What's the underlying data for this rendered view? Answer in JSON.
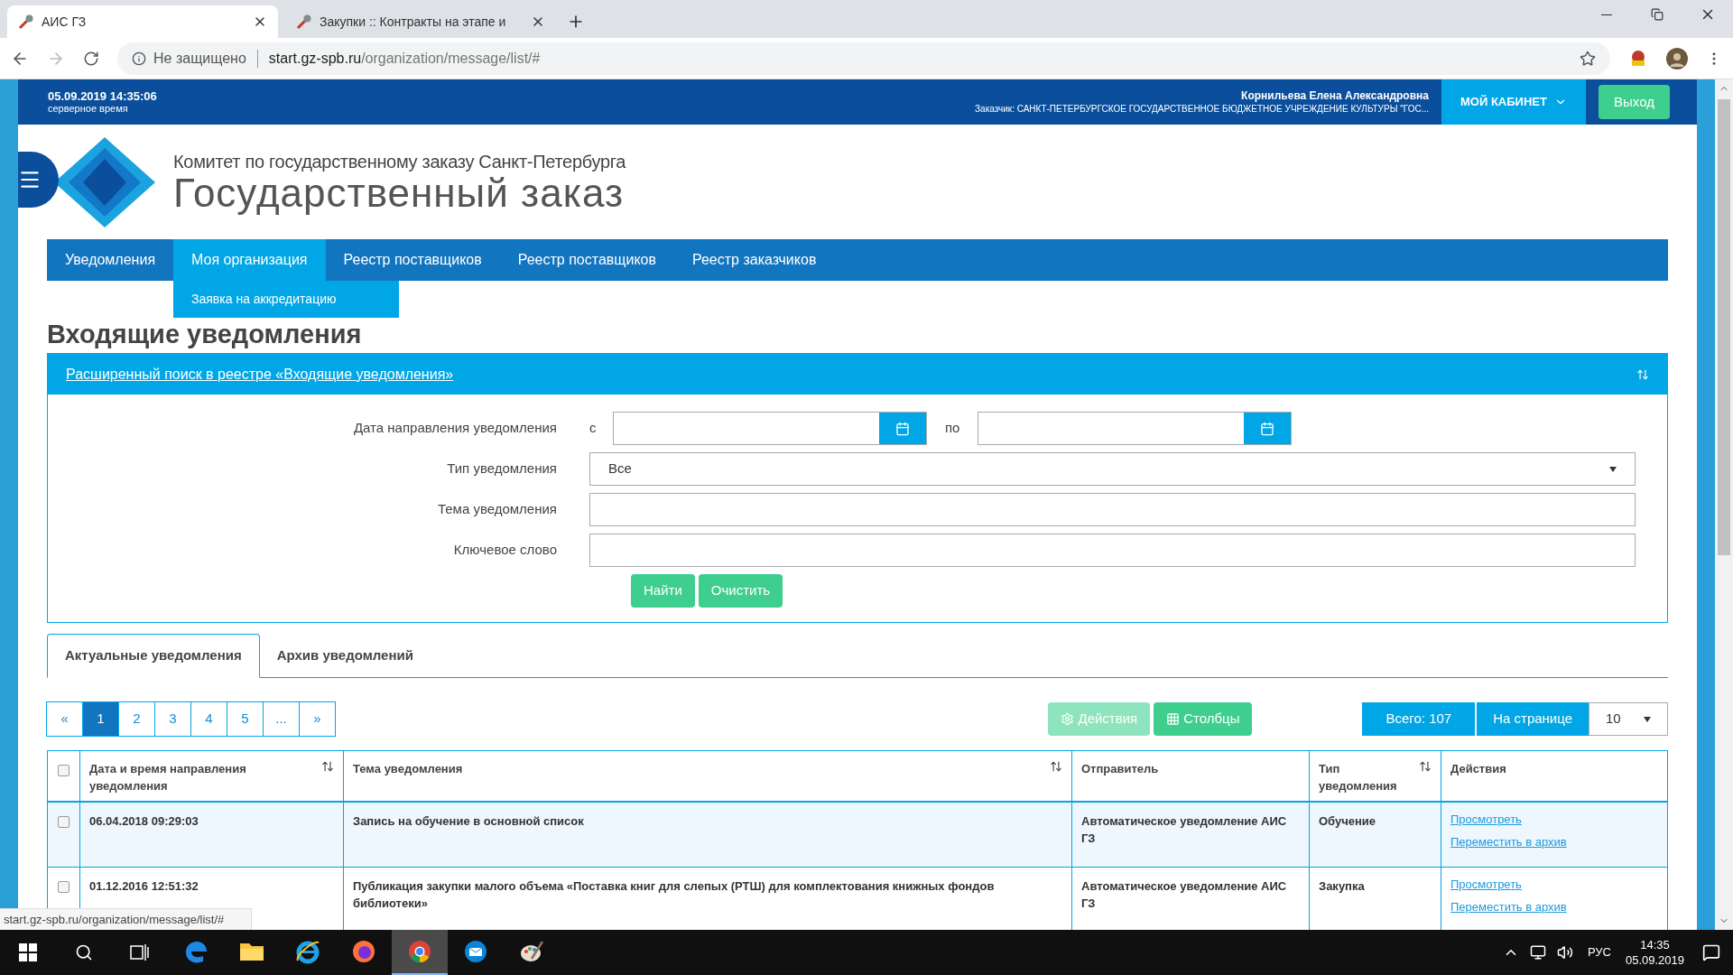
{
  "browser": {
    "tabs": [
      {
        "title": "АИС ГЗ",
        "selected": true
      },
      {
        "title": "Закупки :: Контракты на этапе и",
        "selected": false
      }
    ],
    "address": {
      "security": "Не защищено",
      "host": "start.gz-spb.ru",
      "path": "/organization/message/list/#"
    }
  },
  "header": {
    "datetime": "05.09.2019 14:35:06",
    "time_note": "серверное время",
    "user_name": "Корнильева Елена Александровна",
    "customer": "Заказчик: САНКТ-ПЕТЕРБУРГСКОЕ ГОСУДАРСТВЕННОЕ БЮДЖЕТНОЕ УЧРЕЖДЕНИЕ КУЛЬТУРЫ \"ГОС...",
    "cabinet_button": "МОЙ КАБИНЕТ",
    "logout_button": "Выход"
  },
  "logo": {
    "line1": "Комитет по государственному заказу Санкт-Петербурга",
    "line2": "Государственный заказ"
  },
  "nav": {
    "items": [
      {
        "label": "Уведомления",
        "selected": false
      },
      {
        "label": "Моя организация",
        "selected": true
      },
      {
        "label": "Реестр поставщиков",
        "selected": false
      },
      {
        "label": "Реестр поставщиков",
        "selected": false
      },
      {
        "label": "Реестр заказчиков",
        "selected": false
      }
    ],
    "submenu": [
      "Заявка на аккредитацию"
    ]
  },
  "page_title": "Входящие уведомления",
  "search": {
    "title": "Расширенный поиск в реестре «Входящие уведомления»",
    "fields": [
      {
        "kind": "date_range",
        "label": "Дата направления уведомления",
        "from_label": "с",
        "to_label": "по"
      },
      {
        "kind": "select",
        "label": "Тип уведомления",
        "value": "Все"
      },
      {
        "kind": "text",
        "label": "Тема уведомления"
      },
      {
        "kind": "text",
        "label": "Ключевое слово"
      }
    ],
    "buttons": [
      "Найти",
      "Очистить"
    ]
  },
  "notification_tabs": [
    {
      "label": "Актуальные уведомления",
      "selected": true
    },
    {
      "label": "Архив уведомлений",
      "selected": false
    }
  ],
  "pagination": [
    {
      "label": "«",
      "selected": false
    },
    {
      "label": "1",
      "selected": true
    },
    {
      "label": "2",
      "selected": false
    },
    {
      "label": "3",
      "selected": false
    },
    {
      "label": "4",
      "selected": false
    },
    {
      "label": "5",
      "selected": false
    },
    {
      "label": "...",
      "selected": false
    },
    {
      "label": "»",
      "selected": false
    }
  ],
  "toolbar": {
    "actions_button": {
      "label": "Действия",
      "disabled": true
    },
    "columns_button": "Столбцы",
    "total": "Всего: 107",
    "per_page_label": "На странице",
    "per_page_value": "10"
  },
  "table": {
    "header_checked": false,
    "columns": [
      {
        "label": "Дата и время направления уведомления",
        "sortable": true
      },
      {
        "label": "Тема уведомления",
        "sortable": true
      },
      {
        "label": "Отправитель",
        "sortable": false
      },
      {
        "label": "Тип уведомления",
        "sortable": true
      },
      {
        "label": "Действия",
        "sortable": false
      }
    ],
    "rows": [
      {
        "checked": false,
        "date": "06.04.2018 09:29:03",
        "subject": "Запись на обучение в основной список",
        "sender": "Автоматическое уведомление АИС ГЗ",
        "type": "Обучение",
        "actions": [
          "Просмотреть",
          "Переместить в архив"
        ]
      },
      {
        "checked": false,
        "date": "01.12.2016 12:51:32",
        "subject": "Публикация закупки малого объема «Поставка книг для слепых (РТШ) для комплектования книжных фондов библиотеки»",
        "sender": "Автоматическое уведомление АИС ГЗ",
        "type": "Закупка",
        "actions": [
          "Просмотреть",
          "Переместить в архив"
        ]
      }
    ]
  },
  "status_url": "start.gz-spb.ru/organization/message/list/#",
  "taskbar": {
    "apps": [
      {
        "kind": "edge",
        "active": false
      },
      {
        "kind": "folder",
        "active": false
      },
      {
        "kind": "ie",
        "active": false
      },
      {
        "kind": "firefox",
        "active": false
      },
      {
        "kind": "chrome",
        "active": true
      },
      {
        "kind": "mail",
        "active": false
      },
      {
        "kind": "paint",
        "active": false
      }
    ],
    "language": "РУС",
    "time": "14:35",
    "date": "05.09.2019"
  }
}
